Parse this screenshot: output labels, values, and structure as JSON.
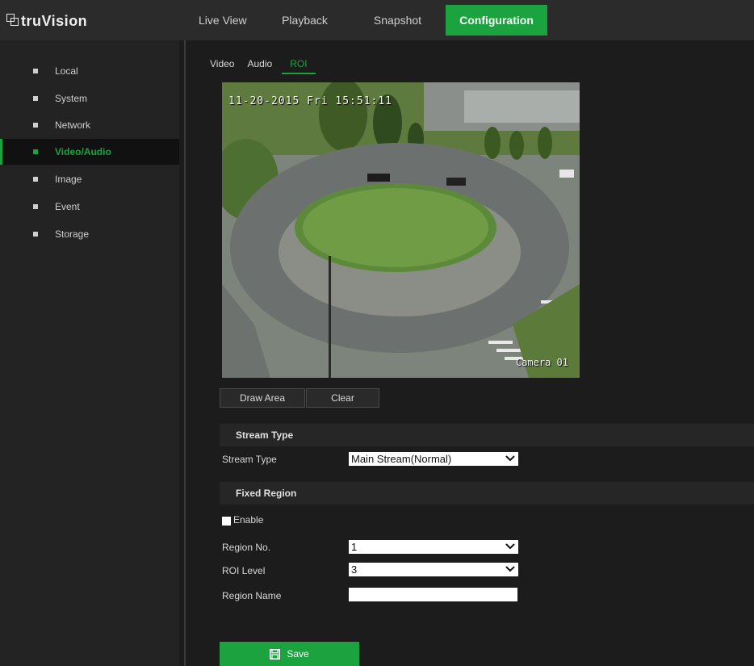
{
  "brand": {
    "name": "truVision"
  },
  "nav": {
    "items": [
      {
        "label": "Live View"
      },
      {
        "label": "Playback"
      },
      {
        "label": "Snapshot"
      },
      {
        "label": "Configuration"
      }
    ],
    "active_index": 3
  },
  "sidebar": {
    "items": [
      {
        "label": "Local"
      },
      {
        "label": "System"
      },
      {
        "label": "Network"
      },
      {
        "label": "Video/Audio"
      },
      {
        "label": "Image"
      },
      {
        "label": "Event"
      },
      {
        "label": "Storage"
      }
    ],
    "active_index": 3
  },
  "subtabs": {
    "items": [
      {
        "label": "Video"
      },
      {
        "label": "Audio"
      },
      {
        "label": "ROI"
      }
    ],
    "active_index": 2
  },
  "video": {
    "osd_date": "11-20-2015 Fri 15:51:11",
    "osd_camera": "Camera 01"
  },
  "buttons": {
    "draw_area": "Draw Area",
    "clear": "Clear",
    "save": "Save"
  },
  "stream_section": {
    "heading": "Stream Type",
    "stream_type_label": "Stream Type",
    "stream_type_value": "Main Stream(Normal)"
  },
  "fixed_region": {
    "heading": "Fixed Region",
    "enable_label": "Enable",
    "enable_checked": false,
    "region_no_label": "Region No.",
    "region_no_value": "1",
    "roi_level_label": "ROI Level",
    "roi_level_value": "3",
    "region_name_label": "Region Name",
    "region_name_value": ""
  },
  "colors": {
    "accent": "#1aa33f",
    "background": "#1c1c1c",
    "sidebar": "#232323"
  }
}
